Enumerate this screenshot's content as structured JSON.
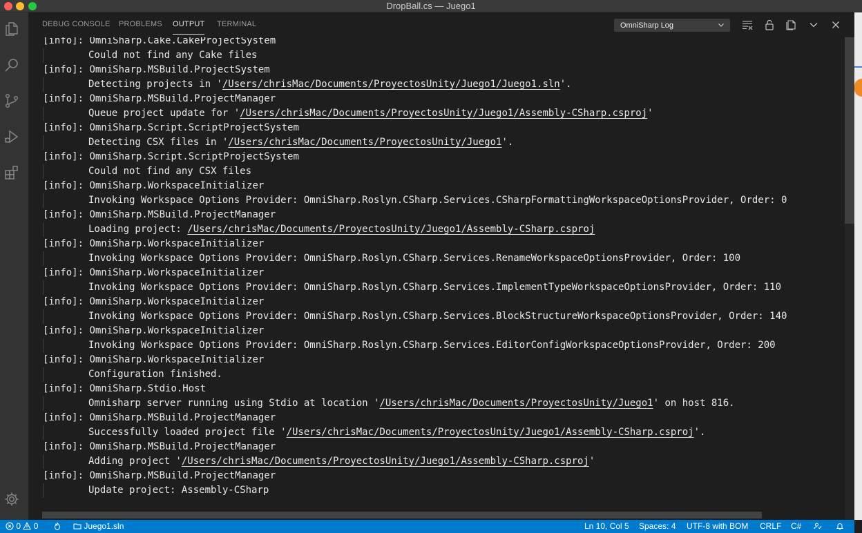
{
  "window": {
    "title": "DropBall.cs — Juego1"
  },
  "panel": {
    "tabs": [
      "DEBUG CONSOLE",
      "PROBLEMS",
      "OUTPUT",
      "TERMINAL"
    ],
    "active_tab": "OUTPUT",
    "channel": "OmniSharp Log"
  },
  "output_lines": [
    {
      "prefix": "[info]: ",
      "text": "OmniSharp.Cake.CakeProjectSystem"
    },
    {
      "text": "Could not find any Cake files"
    },
    {
      "prefix": "[info]: ",
      "text": "OmniSharp.MSBuild.ProjectSystem"
    },
    {
      "pre": "Detecting projects in '",
      "path": "/Users/chrisMac/Documents/ProyectosUnity/Juego1/Juego1.sln",
      "post": "'."
    },
    {
      "prefix": "[info]: ",
      "text": "OmniSharp.MSBuild.ProjectManager"
    },
    {
      "pre": "Queue project update for '",
      "path": "/Users/chrisMac/Documents/ProyectosUnity/Juego1/Assembly-CSharp.csproj",
      "post": "'"
    },
    {
      "prefix": "[info]: ",
      "text": "OmniSharp.Script.ScriptProjectSystem"
    },
    {
      "pre": "Detecting CSX files in '",
      "path": "/Users/chrisMac/Documents/ProyectosUnity/Juego1",
      "post": "'."
    },
    {
      "prefix": "[info]: ",
      "text": "OmniSharp.Script.ScriptProjectSystem"
    },
    {
      "text": "Could not find any CSX files"
    },
    {
      "prefix": "[info]: ",
      "text": "OmniSharp.WorkspaceInitializer"
    },
    {
      "text": "Invoking Workspace Options Provider: OmniSharp.Roslyn.CSharp.Services.CSharpFormattingWorkspaceOptionsProvider, Order: 0"
    },
    {
      "prefix": "[info]: ",
      "text": "OmniSharp.MSBuild.ProjectManager"
    },
    {
      "pre": "Loading project: ",
      "path": "/Users/chrisMac/Documents/ProyectosUnity/Juego1/Assembly-CSharp.csproj",
      "post": ""
    },
    {
      "prefix": "[info]: ",
      "text": "OmniSharp.WorkspaceInitializer"
    },
    {
      "text": "Invoking Workspace Options Provider: OmniSharp.Roslyn.CSharp.Services.RenameWorkspaceOptionsProvider, Order: 100"
    },
    {
      "prefix": "[info]: ",
      "text": "OmniSharp.WorkspaceInitializer"
    },
    {
      "text": "Invoking Workspace Options Provider: OmniSharp.Roslyn.CSharp.Services.ImplementTypeWorkspaceOptionsProvider, Order: 110"
    },
    {
      "prefix": "[info]: ",
      "text": "OmniSharp.WorkspaceInitializer"
    },
    {
      "text": "Invoking Workspace Options Provider: OmniSharp.Roslyn.CSharp.Services.BlockStructureWorkspaceOptionsProvider, Order: 140"
    },
    {
      "prefix": "[info]: ",
      "text": "OmniSharp.WorkspaceInitializer"
    },
    {
      "text": "Invoking Workspace Options Provider: OmniSharp.Roslyn.CSharp.Services.EditorConfigWorkspaceOptionsProvider, Order: 200"
    },
    {
      "prefix": "[info]: ",
      "text": "OmniSharp.WorkspaceInitializer"
    },
    {
      "text": "Configuration finished."
    },
    {
      "prefix": "[info]: ",
      "text": "OmniSharp.Stdio.Host"
    },
    {
      "pre": "Omnisharp server running using Stdio at location '",
      "path": "/Users/chrisMac/Documents/ProyectosUnity/Juego1",
      "post": "' on host 816."
    },
    {
      "prefix": "[info]: ",
      "text": "OmniSharp.MSBuild.ProjectManager"
    },
    {
      "pre": "Successfully loaded project file '",
      "path": "/Users/chrisMac/Documents/ProyectosUnity/Juego1/Assembly-CSharp.csproj",
      "post": "'."
    },
    {
      "prefix": "[info]: ",
      "text": "OmniSharp.MSBuild.ProjectManager"
    },
    {
      "pre": "Adding project '",
      "path": "/Users/chrisMac/Documents/ProyectosUnity/Juego1/Assembly-CSharp.csproj",
      "post": "'"
    },
    {
      "prefix": "[info]: ",
      "text": "OmniSharp.MSBuild.ProjectManager"
    },
    {
      "text": "Update project: Assembly-CSharp"
    }
  ],
  "statusbar": {
    "errors": "0",
    "warnings": "0",
    "solution": "Juego1.sln",
    "position": "Ln 10, Col 5",
    "spaces": "Spaces: 4",
    "encoding": "UTF-8 with BOM",
    "eol": "CRLF",
    "language": "C#"
  },
  "colors": {
    "statusbar": "#007acc",
    "activity_bar": "#333333",
    "editor_bg": "#1e1e1e"
  }
}
